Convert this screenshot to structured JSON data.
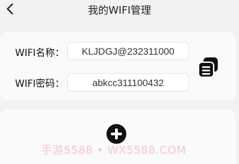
{
  "header": {
    "title": "我的WIFI管理",
    "back_icon": "chevron-left-icon"
  },
  "wifi": {
    "name_label": "WIFI名称：",
    "name_value": "KLJDGJ@232311000",
    "password_label": "WIFI密码：",
    "password_value": "abkcc311100432",
    "copy_icon": "copy-icon"
  },
  "actions": {
    "add_icon": "plus-circle-icon"
  },
  "watermark": {
    "text": "手游5588 • WX5588.COM"
  }
}
